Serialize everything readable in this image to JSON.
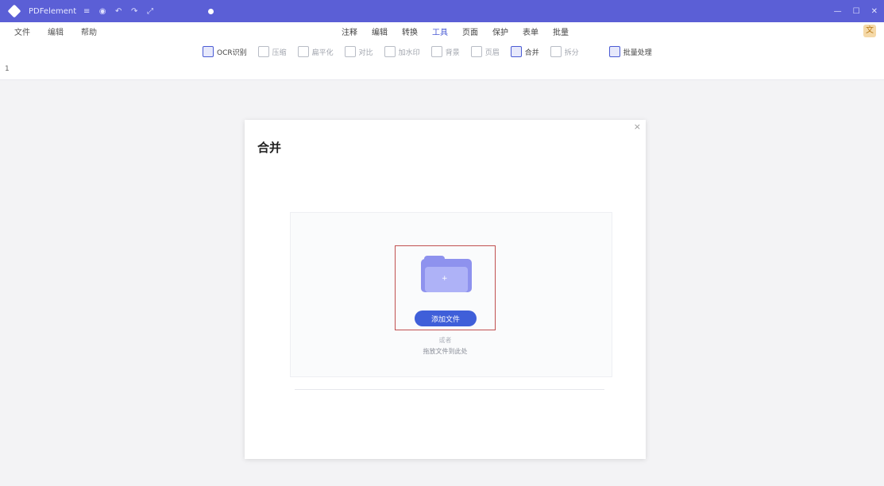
{
  "titlebar": {
    "title": "PDFelement",
    "icons": [
      "≡",
      "◉",
      "↶",
      "↷",
      "⤢"
    ],
    "window_controls": [
      "—",
      "☐",
      "✕"
    ]
  },
  "menu": [
    "文件",
    "编辑",
    "帮助"
  ],
  "tabs": [
    {
      "label": "注释",
      "active": false
    },
    {
      "label": "编辑",
      "active": false
    },
    {
      "label": "转换",
      "active": false
    },
    {
      "label": "工具",
      "active": true
    },
    {
      "label": "页面",
      "active": false
    },
    {
      "label": "保护",
      "active": false
    },
    {
      "label": "表单",
      "active": false
    },
    {
      "label": "批量",
      "active": false
    }
  ],
  "avatar_label": "文",
  "toolbar": [
    {
      "label": "OCR识别",
      "on": true
    },
    {
      "label": "压缩",
      "on": false
    },
    {
      "label": "扁平化",
      "on": false
    },
    {
      "label": "对比",
      "on": false
    },
    {
      "label": "加水印",
      "on": false
    },
    {
      "label": "背景",
      "on": false
    },
    {
      "label": "页眉",
      "on": false
    },
    {
      "label": "合并",
      "on": true
    },
    {
      "label": "拆分",
      "on": false
    },
    {
      "label": "批量处理",
      "on": true
    }
  ],
  "sidebar_number": "1",
  "dialog": {
    "title": "合并",
    "close": "×",
    "folder_mark": "+",
    "add_button": "添加文件",
    "small_text": "或者",
    "hint": "拖放文件到此处"
  }
}
